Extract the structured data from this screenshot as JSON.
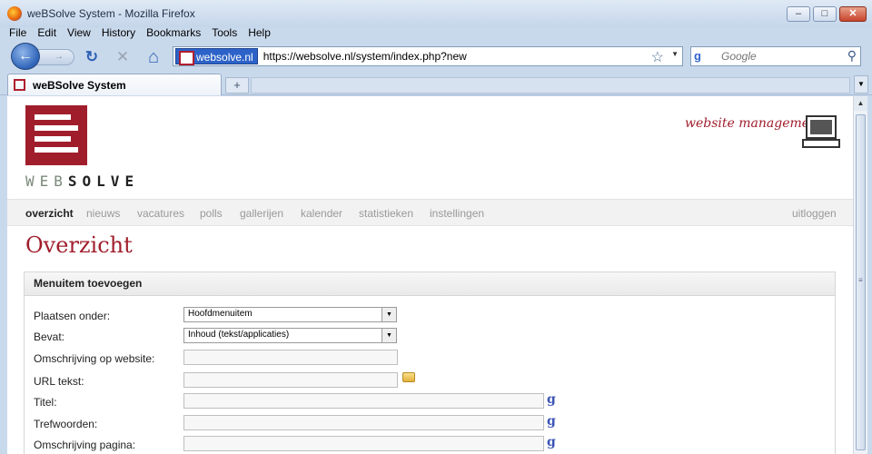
{
  "window": {
    "title": "weBSolve System - Mozilla Firefox",
    "min": "–",
    "max": "□",
    "close": "✕"
  },
  "menu": [
    "File",
    "Edit",
    "View",
    "History",
    "Bookmarks",
    "Tools",
    "Help"
  ],
  "nav": {
    "back": "←",
    "forward": "→",
    "reload": "↻",
    "stop": "✕",
    "home": "⌂",
    "site_identity": "websolve.nl",
    "url": "https://websolve.nl/system/index.php?new",
    "star": "☆",
    "url_dropdown": "▼",
    "search_engine": "g",
    "search_placeholder": "Google",
    "search_icon": "⚲"
  },
  "tabs": {
    "active_label": "weBSolve System",
    "new_tab": "+",
    "list": "▼"
  },
  "page": {
    "tagline": "website management",
    "logo_web": "WEB",
    "logo_solve": "SOLVE",
    "topnav": [
      {
        "label": "overzicht",
        "active": true
      },
      {
        "label": "nieuws"
      },
      {
        "label": "vacatures"
      },
      {
        "label": "polls"
      },
      {
        "label": "gallerijen"
      },
      {
        "label": "kalender"
      },
      {
        "label": "statistieken"
      },
      {
        "label": "instellingen"
      }
    ],
    "logout": "uitloggen",
    "heading": "Overzicht",
    "panel": {
      "title": "Menuitem toevoegen",
      "fields": {
        "plaatsen": {
          "label": "Plaatsen onder:",
          "value": "Hoofdmenuitem"
        },
        "bevat": {
          "label": "Bevat:",
          "value": "Inhoud (tekst/applicaties)"
        },
        "omschrijving": {
          "label": "Omschrijving op website:",
          "value": ""
        },
        "url": {
          "label": "URL tekst:",
          "value": ""
        },
        "titel": {
          "label": "Titel:",
          "value": ""
        },
        "trefwoorden": {
          "label": "Trefwoorden:",
          "value": ""
        },
        "omschrijving_pagina": {
          "label": "Omschrijving pagina:",
          "value": ""
        }
      },
      "google_link": "g",
      "dropdown_arrow": "▼"
    }
  },
  "scrollbar": {
    "up": "▲",
    "grip": "≡"
  },
  "colors": {
    "brand": "#a01e2c",
    "accent": "#2d63c8"
  }
}
